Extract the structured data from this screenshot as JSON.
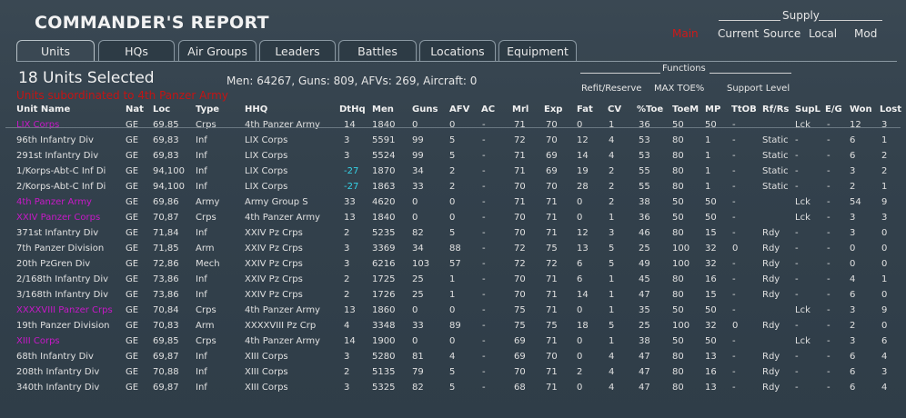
{
  "window": {
    "title": "COMMANDER'S REPORT"
  },
  "supply_header": {
    "label": "Supply",
    "current": "Current",
    "source": "Source",
    "local": "Local",
    "mod": "Mod",
    "main": "Main"
  },
  "tabs": [
    {
      "label": "Units",
      "active": true
    },
    {
      "label": "HQs"
    },
    {
      "label": "Air Groups"
    },
    {
      "label": "Leaders"
    },
    {
      "label": "Battles"
    },
    {
      "label": "Locations"
    },
    {
      "label": "Equipment"
    }
  ],
  "summary": {
    "count_text": "18 Units Selected",
    "stats_text": "Men: 64267, Guns: 809, AFVs: 269, Aircraft: 0",
    "subordinate_text": "Units subordinated to 4th Panzer Army"
  },
  "functions": {
    "label": "Functions",
    "refit_reserve": "Refit/Reserve",
    "max_toe": "MAX TOE%",
    "support_level": "Support Level"
  },
  "columns": {
    "name": "Unit Name",
    "nat": "Nat",
    "loc": "Loc",
    "type": "Type",
    "hhq": "HHQ",
    "dthq": "DtHq",
    "men": "Men",
    "guns": "Guns",
    "afv": "AFV",
    "ac": "AC",
    "mrl": "Mrl",
    "exp": "Exp",
    "fat": "Fat",
    "cv": "CV",
    "toe": "%Toe",
    "toem": "ToeM",
    "mp": "MP",
    "ttob": "TtOB",
    "rfrs": "Rf/Rs",
    "supl": "SupL",
    "eg": "E/G",
    "won": "Won",
    "lost": "Lost"
  },
  "colors": {
    "hq_unit": "#c818c8",
    "dthq_highlight": "#35d4e8",
    "alert_red": "#c41414"
  },
  "rows": [
    {
      "name": "LIX Corps",
      "hq": true,
      "nat": "GE",
      "loc": "69,85",
      "type": "Crps",
      "hhq": "4th Panzer Army",
      "dthq": "14",
      "men": "1840",
      "guns": "0",
      "afv": "0",
      "ac": "-",
      "mrl": "71",
      "exp": "70",
      "fat": "0",
      "cv": "1",
      "toe": "36",
      "toem": "50",
      "mp": "50",
      "ttob": "-",
      "rfrs": "",
      "supl": "Lck",
      "eg": "-",
      "won": "12",
      "lost": "3"
    },
    {
      "name": "96th Infantry Div",
      "nat": "GE",
      "loc": "69,83",
      "type": "Inf",
      "hhq": "LIX Corps",
      "dthq": "3",
      "men": "5591",
      "guns": "99",
      "afv": "5",
      "ac": "-",
      "mrl": "72",
      "exp": "70",
      "fat": "12",
      "cv": "4",
      "toe": "53",
      "toem": "80",
      "mp": "1",
      "ttob": "-",
      "rfrs": "Static",
      "supl": "-",
      "eg": "-",
      "won": "6",
      "lost": "1"
    },
    {
      "name": "291st Infantry Div",
      "nat": "GE",
      "loc": "69,83",
      "type": "Inf",
      "hhq": "LIX Corps",
      "dthq": "3",
      "men": "5524",
      "guns": "99",
      "afv": "5",
      "ac": "-",
      "mrl": "71",
      "exp": "69",
      "fat": "14",
      "cv": "4",
      "toe": "53",
      "toem": "80",
      "mp": "1",
      "ttob": "-",
      "rfrs": "Static",
      "supl": "-",
      "eg": "-",
      "won": "6",
      "lost": "2"
    },
    {
      "name": "1/Korps-Abt-C Inf Di",
      "nat": "GE",
      "loc": "94,100",
      "type": "Inf",
      "hhq": "LIX Corps",
      "dthq": "-27",
      "dthq_cyan": true,
      "men": "1870",
      "guns": "34",
      "afv": "2",
      "ac": "-",
      "mrl": "71",
      "exp": "69",
      "fat": "19",
      "cv": "2",
      "toe": "55",
      "toem": "80",
      "mp": "1",
      "ttob": "-",
      "rfrs": "Static",
      "supl": "-",
      "eg": "-",
      "won": "3",
      "lost": "2"
    },
    {
      "name": "2/Korps-Abt-C Inf Di",
      "nat": "GE",
      "loc": "94,100",
      "type": "Inf",
      "hhq": "LIX Corps",
      "dthq": "-27",
      "dthq_cyan": true,
      "men": "1863",
      "guns": "33",
      "afv": "2",
      "ac": "-",
      "mrl": "70",
      "exp": "70",
      "fat": "28",
      "cv": "2",
      "toe": "55",
      "toem": "80",
      "mp": "1",
      "ttob": "-",
      "rfrs": "Static",
      "supl": "-",
      "eg": "-",
      "won": "2",
      "lost": "1"
    },
    {
      "name": "4th Panzer Army",
      "hq": true,
      "nat": "GE",
      "loc": "69,86",
      "type": "Army",
      "hhq": "Army Group S",
      "dthq": "33",
      "men": "4620",
      "guns": "0",
      "afv": "0",
      "ac": "-",
      "mrl": "71",
      "exp": "71",
      "fat": "0",
      "cv": "2",
      "toe": "38",
      "toem": "50",
      "mp": "50",
      "ttob": "-",
      "rfrs": "",
      "supl": "Lck",
      "eg": "-",
      "won": "54",
      "lost": "9"
    },
    {
      "name": "XXIV Panzer Corps",
      "hq": true,
      "nat": "GE",
      "loc": "70,87",
      "type": "Crps",
      "hhq": "4th Panzer Army",
      "dthq": "13",
      "men": "1840",
      "guns": "0",
      "afv": "0",
      "ac": "-",
      "mrl": "70",
      "exp": "71",
      "fat": "0",
      "cv": "1",
      "toe": "36",
      "toem": "50",
      "mp": "50",
      "ttob": "-",
      "rfrs": "",
      "supl": "Lck",
      "eg": "-",
      "won": "3",
      "lost": "3"
    },
    {
      "name": "371st Infantry Div",
      "nat": "GE",
      "loc": "71,84",
      "type": "Inf",
      "hhq": "XXIV Pz Crps",
      "dthq": "2",
      "men": "5235",
      "guns": "82",
      "afv": "5",
      "ac": "-",
      "mrl": "70",
      "exp": "71",
      "fat": "12",
      "cv": "3",
      "toe": "46",
      "toem": "80",
      "mp": "15",
      "ttob": "-",
      "rfrs": "Rdy",
      "supl": "-",
      "eg": "-",
      "won": "3",
      "lost": "0"
    },
    {
      "name": "7th Panzer Division",
      "nat": "GE",
      "loc": "71,85",
      "type": "Arm",
      "hhq": "XXIV Pz Crps",
      "dthq": "3",
      "men": "3369",
      "guns": "34",
      "afv": "88",
      "ac": "-",
      "mrl": "72",
      "exp": "75",
      "fat": "13",
      "cv": "5",
      "toe": "25",
      "toem": "100",
      "mp": "32",
      "ttob": "0",
      "rfrs": "Rdy",
      "supl": "-",
      "eg": "-",
      "won": "0",
      "lost": "0"
    },
    {
      "name": "20th PzGren Div",
      "nat": "GE",
      "loc": "72,86",
      "type": "Mech",
      "hhq": "XXIV Pz Crps",
      "dthq": "3",
      "men": "6216",
      "guns": "103",
      "afv": "57",
      "ac": "-",
      "mrl": "72",
      "exp": "72",
      "fat": "6",
      "cv": "5",
      "toe": "49",
      "toem": "100",
      "mp": "32",
      "ttob": "-",
      "rfrs": "Rdy",
      "supl": "-",
      "eg": "-",
      "won": "0",
      "lost": "0"
    },
    {
      "name": "2/168th Infantry Div",
      "nat": "GE",
      "loc": "73,86",
      "type": "Inf",
      "hhq": "XXIV Pz Crps",
      "dthq": "2",
      "men": "1725",
      "guns": "25",
      "afv": "1",
      "ac": "-",
      "mrl": "70",
      "exp": "71",
      "fat": "6",
      "cv": "1",
      "toe": "45",
      "toem": "80",
      "mp": "16",
      "ttob": "-",
      "rfrs": "Rdy",
      "supl": "-",
      "eg": "-",
      "won": "4",
      "lost": "1"
    },
    {
      "name": "3/168th Infantry Div",
      "nat": "GE",
      "loc": "73,86",
      "type": "Inf",
      "hhq": "XXIV Pz Crps",
      "dthq": "2",
      "men": "1726",
      "guns": "25",
      "afv": "1",
      "ac": "-",
      "mrl": "70",
      "exp": "71",
      "fat": "14",
      "cv": "1",
      "toe": "47",
      "toem": "80",
      "mp": "15",
      "ttob": "-",
      "rfrs": "Rdy",
      "supl": "-",
      "eg": "-",
      "won": "6",
      "lost": "0"
    },
    {
      "name": "XXXXVIII Panzer Crps",
      "hq": true,
      "nat": "GE",
      "loc": "70,84",
      "type": "Crps",
      "hhq": "4th Panzer Army",
      "dthq": "13",
      "men": "1860",
      "guns": "0",
      "afv": "0",
      "ac": "-",
      "mrl": "75",
      "exp": "71",
      "fat": "0",
      "cv": "1",
      "toe": "35",
      "toem": "50",
      "mp": "50",
      "ttob": "-",
      "rfrs": "",
      "supl": "Lck",
      "eg": "-",
      "won": "3",
      "lost": "9"
    },
    {
      "name": "19th Panzer Division",
      "nat": "GE",
      "loc": "70,83",
      "type": "Arm",
      "hhq": "XXXXVIII Pz Crp",
      "dthq": "4",
      "men": "3348",
      "guns": "33",
      "afv": "89",
      "ac": "-",
      "mrl": "75",
      "exp": "75",
      "fat": "18",
      "cv": "5",
      "toe": "25",
      "toem": "100",
      "mp": "32",
      "ttob": "0",
      "rfrs": "Rdy",
      "supl": "-",
      "eg": "-",
      "won": "2",
      "lost": "0"
    },
    {
      "name": "XIII Corps",
      "hq": true,
      "nat": "GE",
      "loc": "69,85",
      "type": "Crps",
      "hhq": "4th Panzer Army",
      "dthq": "14",
      "men": "1900",
      "guns": "0",
      "afv": "0",
      "ac": "-",
      "mrl": "69",
      "exp": "71",
      "fat": "0",
      "cv": "1",
      "toe": "38",
      "toem": "50",
      "mp": "50",
      "ttob": "-",
      "rfrs": "",
      "supl": "Lck",
      "eg": "-",
      "won": "3",
      "lost": "6"
    },
    {
      "name": "68th Infantry Div",
      "nat": "GE",
      "loc": "69,87",
      "type": "Inf",
      "hhq": "XIII Corps",
      "dthq": "3",
      "men": "5280",
      "guns": "81",
      "afv": "4",
      "ac": "-",
      "mrl": "69",
      "exp": "70",
      "fat": "0",
      "cv": "4",
      "toe": "47",
      "toem": "80",
      "mp": "13",
      "ttob": "-",
      "rfrs": "Rdy",
      "supl": "-",
      "eg": "-",
      "won": "6",
      "lost": "4"
    },
    {
      "name": "208th Infantry Div",
      "nat": "GE",
      "loc": "70,88",
      "type": "Inf",
      "hhq": "XIII Corps",
      "dthq": "2",
      "men": "5135",
      "guns": "79",
      "afv": "5",
      "ac": "-",
      "mrl": "70",
      "exp": "71",
      "fat": "2",
      "cv": "4",
      "toe": "47",
      "toem": "80",
      "mp": "16",
      "ttob": "-",
      "rfrs": "Rdy",
      "supl": "-",
      "eg": "-",
      "won": "6",
      "lost": "3"
    },
    {
      "name": "340th Infantry Div",
      "nat": "GE",
      "loc": "69,87",
      "type": "Inf",
      "hhq": "XIII Corps",
      "dthq": "3",
      "men": "5325",
      "guns": "82",
      "afv": "5",
      "ac": "-",
      "mrl": "68",
      "exp": "71",
      "fat": "0",
      "cv": "4",
      "toe": "47",
      "toem": "80",
      "mp": "13",
      "ttob": "-",
      "rfrs": "Rdy",
      "supl": "-",
      "eg": "-",
      "won": "6",
      "lost": "4"
    }
  ]
}
